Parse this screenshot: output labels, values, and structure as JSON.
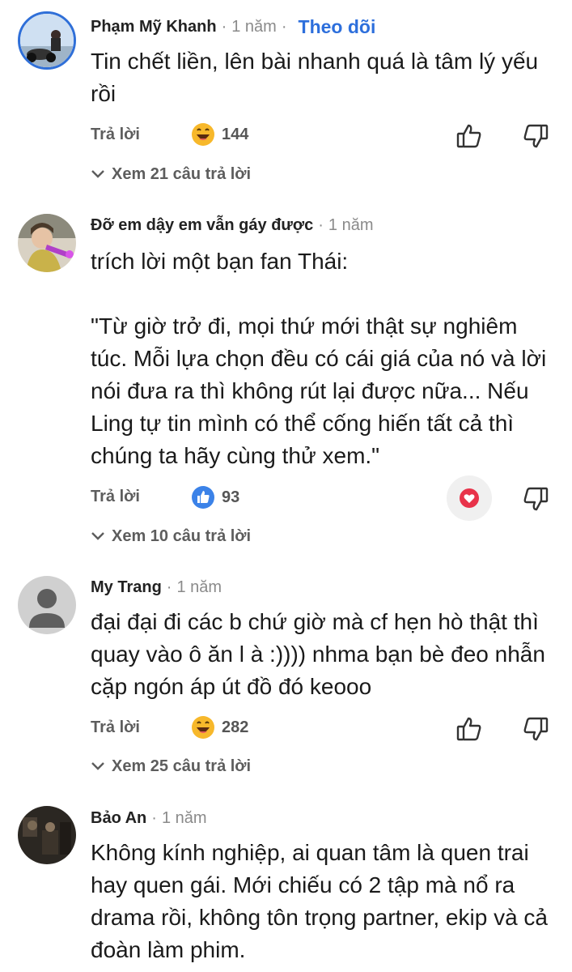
{
  "comments": [
    {
      "author": "Phạm Mỹ Khanh",
      "separator": "·",
      "time": "1 năm",
      "follow_label": "Theo dõi",
      "text": "Tin chết liền, lên bài nhanh quá là tâm lý yếu rồi",
      "reply_label": "Trả lời",
      "reaction_icon": "laugh-emoji",
      "reaction_count": "144",
      "view_replies_label": "Xem 21 câu trả lời"
    },
    {
      "author": "Đỡ em dậy em vẫn gáy được",
      "separator": "·",
      "time": "1 năm",
      "text": "trích lời một bạn fan Thái:\n\n\"Từ giờ trở đi, mọi thứ mới thật sự nghiêm túc. Mỗi lựa chọn đều có cái giá của nó và lời nói đưa ra thì không rút lại được nữa... Nếu Ling tự tin mình có thể cống hiến tất cả thì chúng ta hãy cùng thử xem.\"",
      "reply_label": "Trả lời",
      "reaction_icon": "thumbs-up-blue",
      "reaction_count": "93",
      "author_reaction_icon": "heart-icon",
      "view_replies_label": "Xem 10 câu trả lời"
    },
    {
      "author": "My Trang",
      "separator": "·",
      "time": "1 năm",
      "text": "đại đại đi các b chứ giờ mà cf hẹn hò thật thì quay vào ô ăn l à :)))) nhma bạn bè đeo nhẫn cặp ngón áp út đồ đó keooo",
      "reply_label": "Trả lời",
      "reaction_icon": "laugh-emoji",
      "reaction_count": "282",
      "view_replies_label": "Xem 25 câu trả lời"
    },
    {
      "author": "Bảo An",
      "separator": "·",
      "time": "1 năm",
      "text": "Không kính nghiệp, ai quan tâm là quen trai hay quen gái. Mới chiếu có 2 tập mà nổ ra drama rồi, không tôn trọng partner, ekip và cả đoàn làm phim."
    }
  ],
  "colors": {
    "follow": "#2d6fdc",
    "meta": "#8a8a8a",
    "action": "#5d5d5d",
    "like_blue": "#3b82e8",
    "heart_red": "#e8334a",
    "emoji_yellow": "#f7b82b"
  }
}
